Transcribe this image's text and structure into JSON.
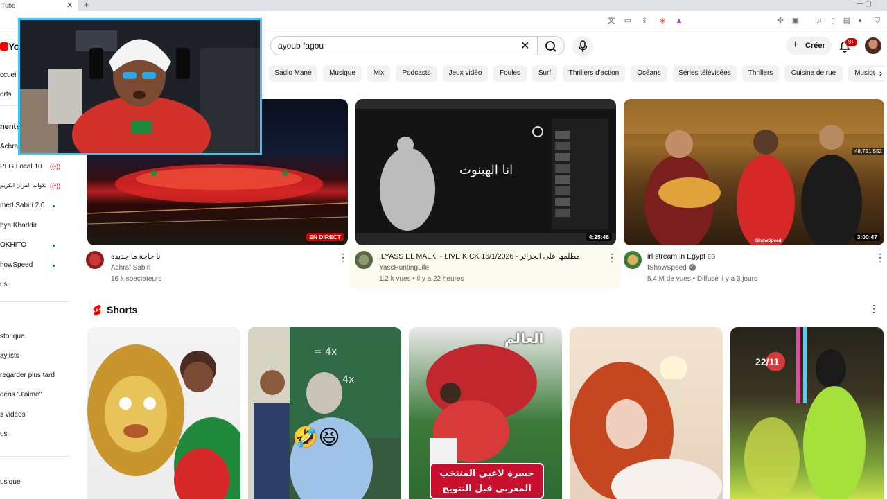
{
  "browser": {
    "tab_title": "Tube",
    "tab_close": "✕",
    "new_tab": "+",
    "window_controls": "—   ▢"
  },
  "header": {
    "logo_text": "You",
    "search_value": "ayoub fagou",
    "create_label": "Créer",
    "notification_count": "9+"
  },
  "chips": [
    "Sadio Mané",
    "Musique",
    "Mix",
    "Podcasts",
    "Jeux vidéo",
    "Foules",
    "Surf",
    "Thrillers d'action",
    "Océans",
    "Séries télévisées",
    "Thrillers",
    "Cuisine de rue",
    "Musique"
  ],
  "sidebar": {
    "home": "ccueil",
    "shorts": "orts",
    "subscriptions_heading": "nents",
    "subs": [
      "Achraf Sabiri",
      "PLG Local 10",
      "تلاوات القرآن الكريم",
      "med Sabiri 2.0",
      "hya Khaddir",
      "OKHITO",
      "howSpeed",
      "us"
    ],
    "you": [
      "storique",
      "aylists",
      "regarder plus tard",
      "déos \"J'aime\"",
      "s vidéos",
      "us"
    ],
    "explore": "usique"
  },
  "videos": [
    {
      "title": "نا حاجة ما جديدة",
      "channel": "Achraf Sabiri",
      "meta": "16 k spectateurs",
      "badge": "EN DIRECT"
    },
    {
      "title": "ILYASS EL MALKI - LIVE KICK 16/1/2026 - مطلمها على الجزائر",
      "channel": "YassHuntingLife",
      "meta": "1,2 k vues • il y a 22 heures",
      "badge": "4:25:48",
      "thumb_text": "انا الهبنوت"
    },
    {
      "title": "irl stream in Egypt",
      "title_suffix": "EG",
      "channel": "IShowSpeed",
      "meta": "5,4 M de vues • Diffusé il y a 3 jours",
      "badge": "3:00:47",
      "corner_count": "48,751,552",
      "thumb_logo": "IShowSpeed"
    }
  ],
  "shorts": {
    "title": "Shorts",
    "items": [
      {
        "overlay": ""
      },
      {
        "overlay": "🤣😆"
      },
      {
        "overlay_logo": "العالم",
        "caption_line1": "حسرة لاعبي المنتخب",
        "caption_line2": "المغربي قبل التتويج"
      },
      {
        "overlay": ""
      },
      {
        "overlay": "22/11"
      }
    ]
  },
  "colors": {
    "youtube_red": "#ff0000",
    "live_red": "#cc0000",
    "webcam_border": "#36c8f2",
    "chip_bg": "#f2f2f2",
    "link_blue": "#065fd4"
  }
}
